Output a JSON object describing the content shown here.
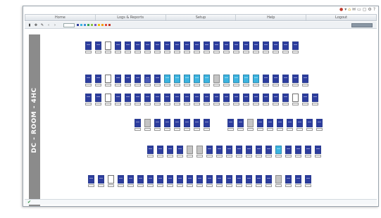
{
  "menu": {
    "items": [
      {
        "label": "Home"
      },
      {
        "label": "Logs & Reports"
      },
      {
        "label": "Setup"
      },
      {
        "label": "Help"
      },
      {
        "label": "Logout"
      }
    ]
  },
  "room": {
    "label": "DC - ROOM - 4HC"
  },
  "colors": {
    "occupied": "#2d3d9e",
    "partial": "#3cb4e0",
    "reserved": "#c4c4c4",
    "empty": "#ffffff",
    "accent_line": "#3fa9d6"
  },
  "racks": {
    "row1": [
      "full",
      "full",
      "empty",
      "full",
      "full",
      "full",
      "full",
      "full",
      "full",
      "full",
      "full",
      "full",
      "full",
      "full",
      "full",
      "full",
      "full",
      "full",
      "full",
      "full",
      "full",
      "full"
    ],
    "row2": [
      "full",
      "full",
      "empty",
      "full",
      "full",
      "full",
      "mid",
      "full",
      "light",
      "light",
      "light",
      "light",
      "light",
      "gray",
      "light",
      "light",
      "light",
      "light",
      "full",
      "full",
      "full",
      "full",
      "full"
    ],
    "row3": [
      "full",
      "full",
      "empty",
      "full",
      "full",
      "full",
      "full",
      "full",
      "full",
      "full",
      "full",
      "full",
      "full",
      "full",
      "full",
      "full",
      "full",
      "full",
      "full",
      "full",
      "full",
      "empty",
      "full",
      "full"
    ],
    "row4a": [
      "full",
      "gray",
      "full",
      "full",
      "full",
      "full",
      "full",
      "full"
    ],
    "row4b": [
      "full",
      "full",
      "gray",
      "full",
      "full",
      "full",
      "full",
      "full",
      "full",
      "full"
    ],
    "row5": [
      "full",
      "full",
      "full",
      "full",
      "gray",
      "gray",
      "full",
      "full",
      "full",
      "full",
      "full",
      "full",
      "full",
      "light",
      "full",
      "full",
      "full",
      "full"
    ],
    "row6": [
      "full",
      "full",
      "empty",
      "full",
      "full",
      "full",
      "full",
      "full",
      "full",
      "full",
      "full",
      "full",
      "full",
      "full",
      "full",
      "full",
      "full",
      "full",
      "full",
      "gray",
      "full",
      "full",
      "full"
    ]
  }
}
